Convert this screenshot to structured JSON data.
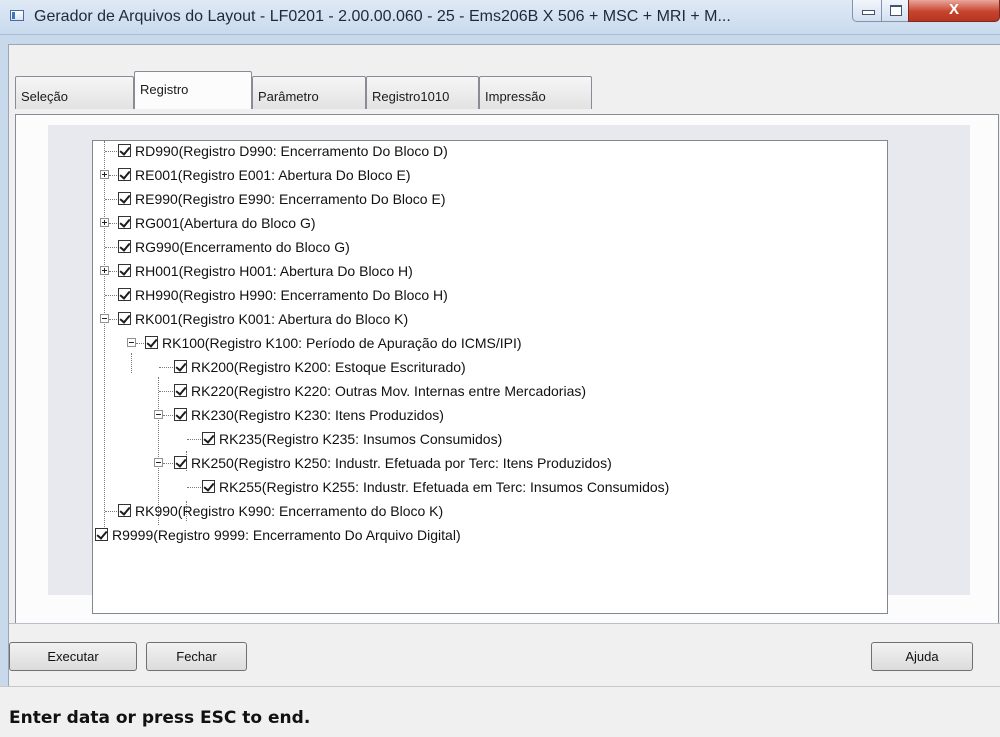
{
  "window": {
    "title": "Gerador de Arquivos do Layout - LF0201 - 2.00.00.060 - 25 - Ems206B X 506 + MSC + MRI + M...",
    "close_glyph": "X"
  },
  "tabs": [
    {
      "label": "Seleção",
      "active": false
    },
    {
      "label": "Registro",
      "active": true
    },
    {
      "label": "Parâmetro",
      "active": false
    },
    {
      "label": "Registro1010",
      "active": false
    },
    {
      "label": "Impressão",
      "active": false
    }
  ],
  "tree": {
    "items": [
      {
        "label": "RD990(Registro D990: Encerramento Do Bloco D)",
        "checked": true,
        "expander": "none",
        "level": 1
      },
      {
        "label": "RE001(Registro E001: Abertura Do Bloco E)",
        "checked": true,
        "expander": "plus",
        "level": 1
      },
      {
        "label": "RE990(Registro E990: Encerramento Do Bloco E)",
        "checked": true,
        "expander": "none",
        "level": 1
      },
      {
        "label": "RG001(Abertura do Bloco G)",
        "checked": true,
        "expander": "plus",
        "level": 1
      },
      {
        "label": "RG990(Encerramento do Bloco G)",
        "checked": true,
        "expander": "none",
        "level": 1
      },
      {
        "label": "RH001(Registro H001: Abertura Do Bloco H)",
        "checked": true,
        "expander": "plus",
        "level": 1
      },
      {
        "label": "RH990(Registro H990: Encerramento Do Bloco H)",
        "checked": true,
        "expander": "none",
        "level": 1
      },
      {
        "label": "RK001(Registro K001: Abertura do Bloco K)",
        "checked": true,
        "expander": "minus",
        "level": 1
      },
      {
        "label": "RK100(Registro K100: Período de Apuração do ICMS/IPI)",
        "checked": true,
        "expander": "minus",
        "level": 2
      },
      {
        "label": "RK200(Registro K200: Estoque Escriturado)",
        "checked": true,
        "expander": "none",
        "level": 3
      },
      {
        "label": "RK220(Registro K220: Outras Mov. Internas entre Mercadorias)",
        "checked": true,
        "expander": "none",
        "level": 3
      },
      {
        "label": "RK230(Registro K230: Itens Produzidos)",
        "checked": true,
        "expander": "minus",
        "level": 3
      },
      {
        "label": "RK235(Registro K235: Insumos Consumidos)",
        "checked": true,
        "expander": "none",
        "level": 4
      },
      {
        "label": "RK250(Registro K250: Industr. Efetuada por Terc: Itens Produzidos)",
        "checked": true,
        "expander": "minus",
        "level": 3
      },
      {
        "label": "RK255(Registro K255: Industr. Efetuada em Terc: Insumos Consumidos)",
        "checked": true,
        "expander": "none",
        "level": 4
      },
      {
        "label": "RK990(Registro K990: Encerramento do Bloco K)",
        "checked": true,
        "expander": "none",
        "level": 1
      },
      {
        "label": "R9999(Registro 9999: Encerramento Do Arquivo Digital)",
        "checked": true,
        "expander": "none",
        "level": 0
      }
    ],
    "scrollbar": {
      "up_icon": "▲",
      "down_icon": "▼",
      "thumb_position_fraction": 0.4
    }
  },
  "buttons": {
    "executar": "Executar",
    "fechar": "Fechar",
    "ajuda": "Ajuda"
  },
  "status": {
    "text": "Enter data or press ESC to end."
  }
}
